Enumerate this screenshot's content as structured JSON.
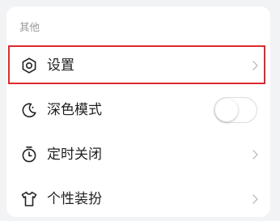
{
  "section": {
    "title": "其他"
  },
  "items": [
    {
      "label": "设置",
      "icon": "gear-icon",
      "trailing": "chevron"
    },
    {
      "label": "深色模式",
      "icon": "moon-icon",
      "trailing": "toggle",
      "toggle_on": false
    },
    {
      "label": "定时关闭",
      "icon": "timer-icon",
      "trailing": "chevron"
    },
    {
      "label": "个性装扮",
      "icon": "tshirt-icon",
      "trailing": "chevron"
    }
  ],
  "colors": {
    "highlight_border": "#e0292e",
    "text": "#1f1f1f",
    "section_title": "#999999",
    "chevron": "#bdbdbd"
  }
}
